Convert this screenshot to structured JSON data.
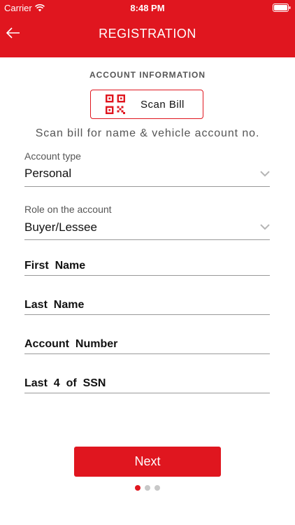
{
  "status_bar": {
    "carrier": "Carrier",
    "time": "8:48 PM"
  },
  "nav": {
    "title": "REGISTRATION",
    "back_icon": "back-arrow-icon"
  },
  "section_title": "ACCOUNT  INFORMATION",
  "scan": {
    "button_label": "Scan  Bill",
    "icon": "qr-code-icon",
    "hint": "Scan  bill  for  name  &  vehicle  account  no."
  },
  "form": {
    "account_type": {
      "label": "Account  type",
      "value": "Personal"
    },
    "role": {
      "label": "Role  on  the  account",
      "value": "Buyer/Lessee"
    },
    "first_name": {
      "placeholder": "First  Name"
    },
    "last_name": {
      "placeholder": "Last  Name"
    },
    "account_number": {
      "placeholder": "Account  Number"
    },
    "ssn": {
      "placeholder": "Last  4  of  SSN"
    }
  },
  "next_label": "Next",
  "pager": {
    "active_page": 1,
    "total_pages": 3
  },
  "colors": {
    "accent": "#e0161f"
  }
}
